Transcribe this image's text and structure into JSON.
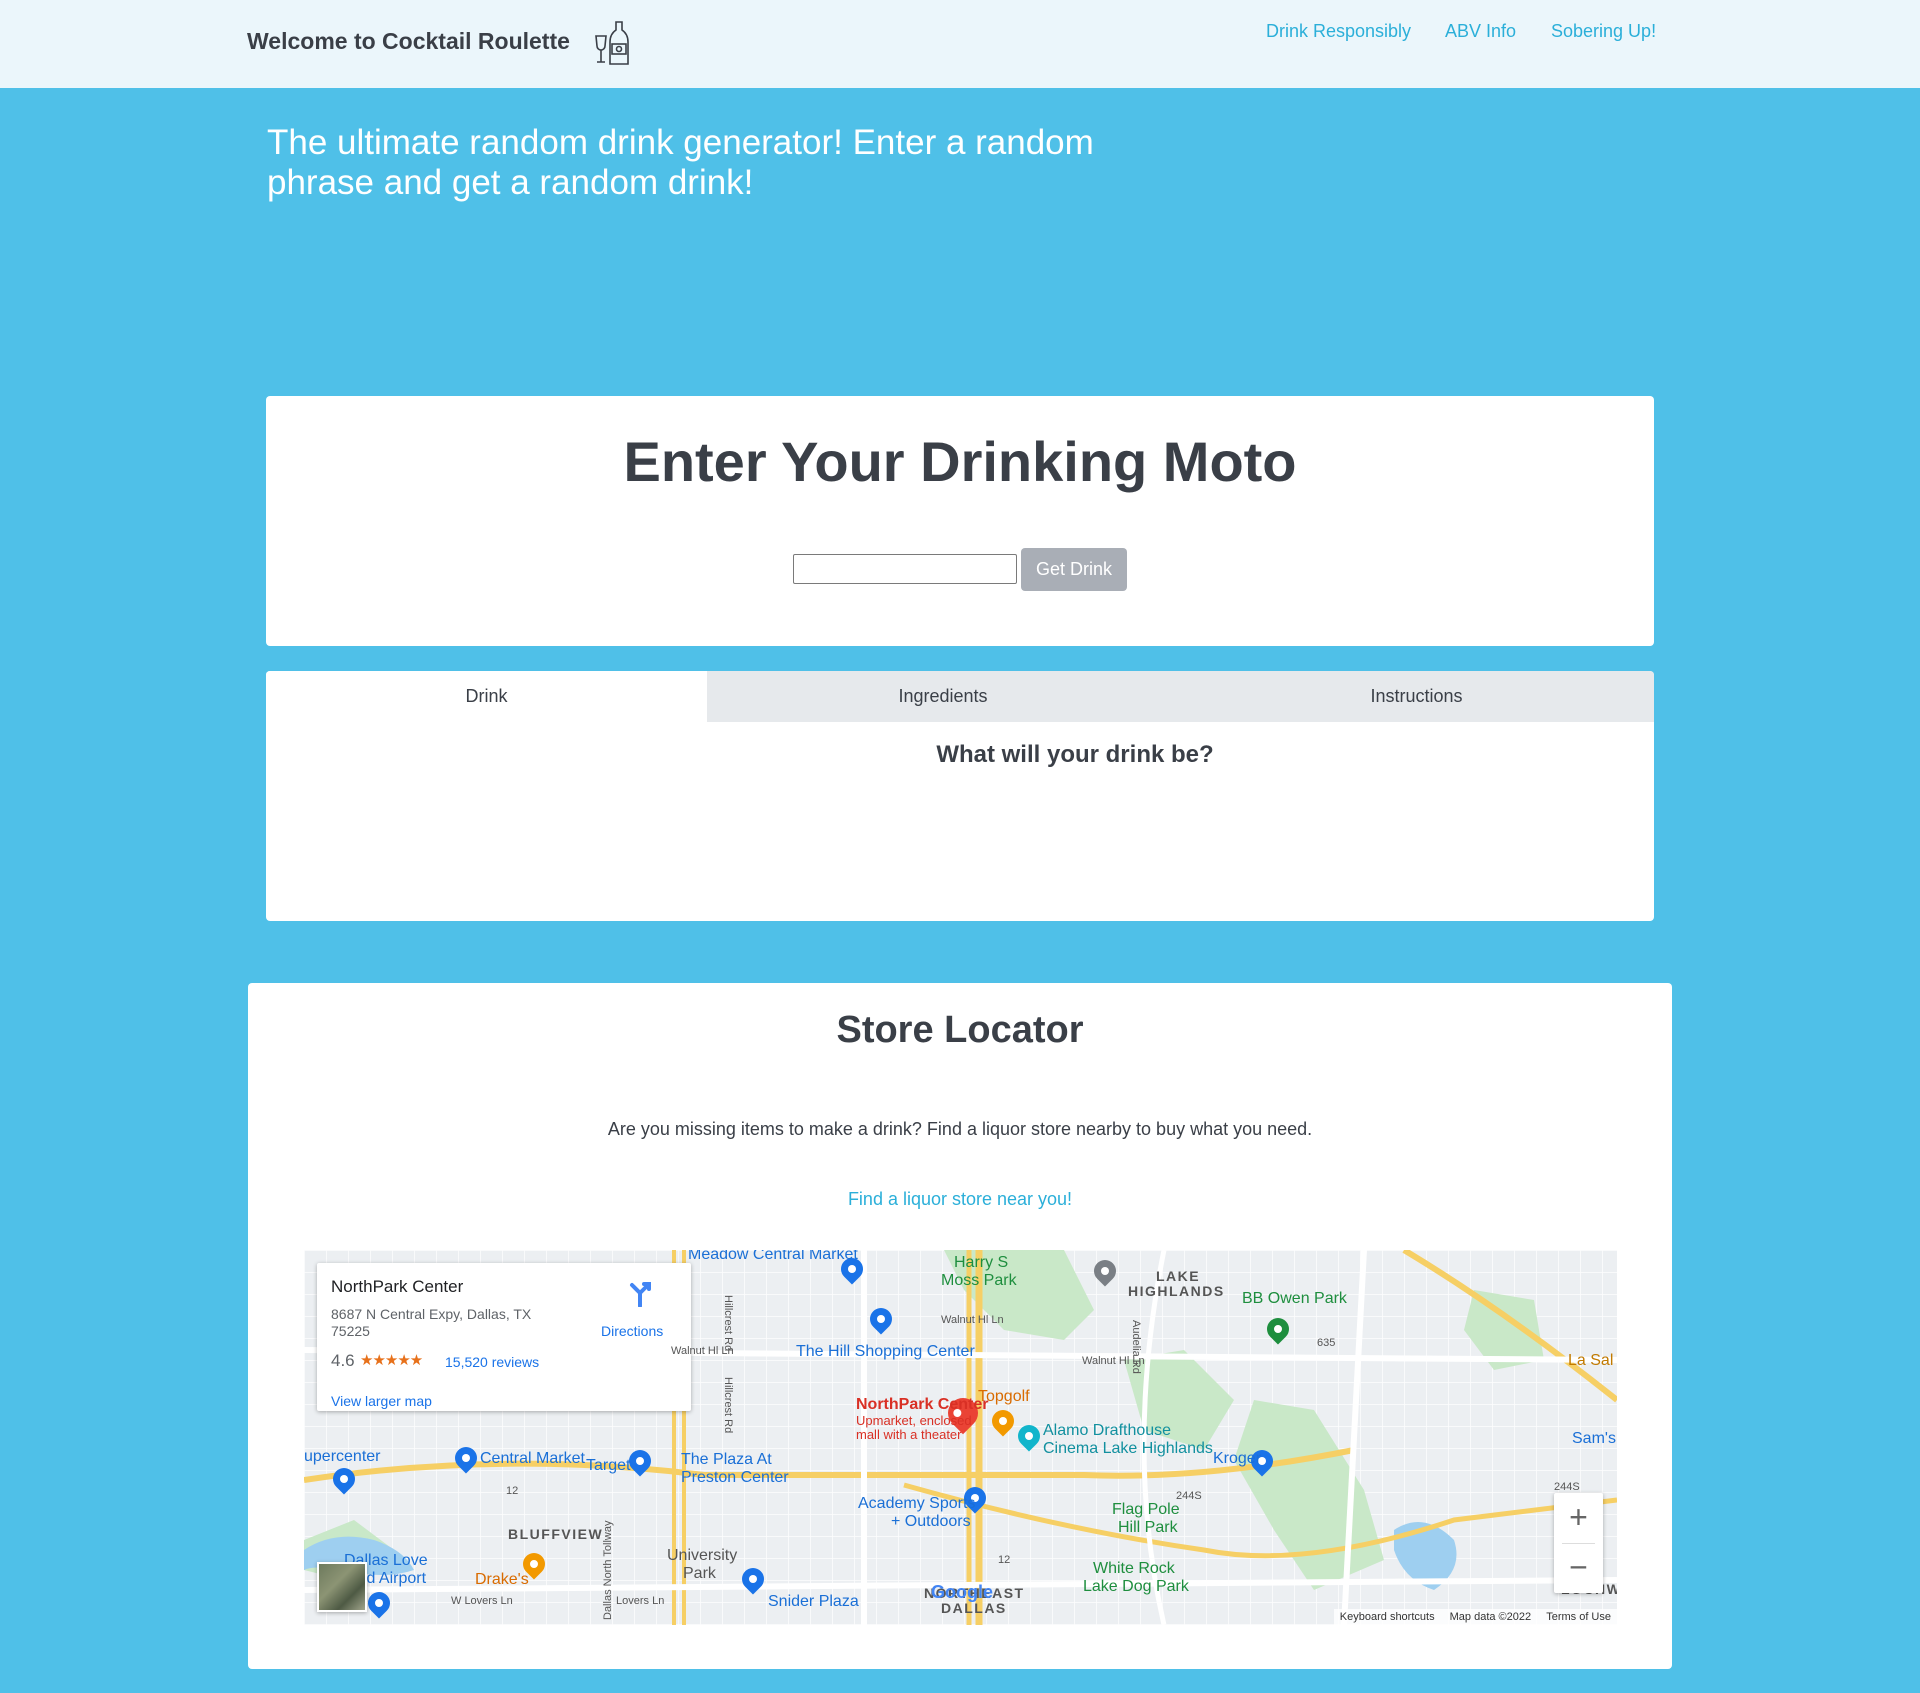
{
  "nav": {
    "brand": "Welcome to Cocktail Roulette",
    "links": [
      "Drink Responsibly",
      "ABV Info",
      "Sobering Up!"
    ]
  },
  "hero": {
    "tagline": "The ultimate random drink generator! Enter a random phrase and get a random drink!"
  },
  "moto": {
    "title": "Enter Your Drinking Moto",
    "input_value": "",
    "button_label": "Get Drink"
  },
  "tabs": {
    "items": [
      "Drink",
      "Ingredients",
      "Instructions"
    ],
    "active": "Drink",
    "prompt": "What will your drink be?"
  },
  "store": {
    "title": "Store Locator",
    "description": "Are you missing items to make a drink? Find a liquor store nearby to buy what you need.",
    "link": "Find a liquor store near you!"
  },
  "map": {
    "place": {
      "name": "NorthPark Center",
      "address": "8687 N Central Expy, Dallas, TX 75225",
      "rating": "4.6",
      "stars": "★★★★★",
      "reviews": "15,520 reviews",
      "larger_map": "View larger map",
      "directions": "Directions"
    },
    "labels": {
      "meadow": "Meadow Central Market",
      "harry1": "Harry S",
      "harry2": "Moss Park",
      "lake1": "LAKE",
      "lake2": "HIGHLANDS",
      "bbowen": "BB Owen Park",
      "hill": "The Hill Shopping Center",
      "northpark": "NorthPark Center",
      "np_sub1": "Upmarket, enclosed",
      "np_sub2": "mall with a theater",
      "topgolf": "Topgolf",
      "alamo1": "Alamo Drafthouse",
      "alamo2": "Cinema Lake Highlands",
      "kroger": "Kroger",
      "sams": "Sam's",
      "lasal": "La Sal",
      "supercenter": "upercenter",
      "central": "Central Market",
      "target": "Target",
      "plaza1": "The Plaza At",
      "plaza2": "Preston Center",
      "academy1": "Academy Sports",
      "academy2": "+ Outdoors",
      "flag1": "Flag Pole",
      "flag2": "Hill Park",
      "bluffview": "BLUFFVIEW",
      "univ1": "University",
      "univ2": "Park",
      "dallas_love1": "Dallas Love",
      "dallas_love2": "eld Airport",
      "drakes": "Drake's",
      "white1": "White Rock",
      "white2": "Lake Dog Park",
      "northeast1": "NORTHEAST",
      "northeast2": "DALLAS",
      "snider": "Snider Plaza",
      "lochw": "LOCHW",
      "walnut1": "Walnut Hl Ln",
      "walnut2": "Walnut Hl Ln",
      "walnut3": "Walnut Hl Ln",
      "lovers1": "W Lovers Ln",
      "lovers2": "Lovers Ln",
      "hillcrest1": "Hillcrest Rd",
      "hillcrest2": "Hillcrest Rd",
      "audelia": "Audelia Rd",
      "tollway": "Dallas North Tollway",
      "r12a": "12",
      "r12b": "12",
      "r244a": "244S",
      "r244b": "244S",
      "r635": "635"
    },
    "google": "Google",
    "attribution": [
      "Keyboard shortcuts",
      "Map data ©2022",
      "Terms of Use"
    ],
    "zoom_in": "+",
    "zoom_out": "−"
  },
  "colors": {
    "background": "#4fc0e8",
    "navbar": "#ebf6fb",
    "link": "#2bafd9",
    "button": "#a9aeb6",
    "text": "#3a3f47"
  }
}
